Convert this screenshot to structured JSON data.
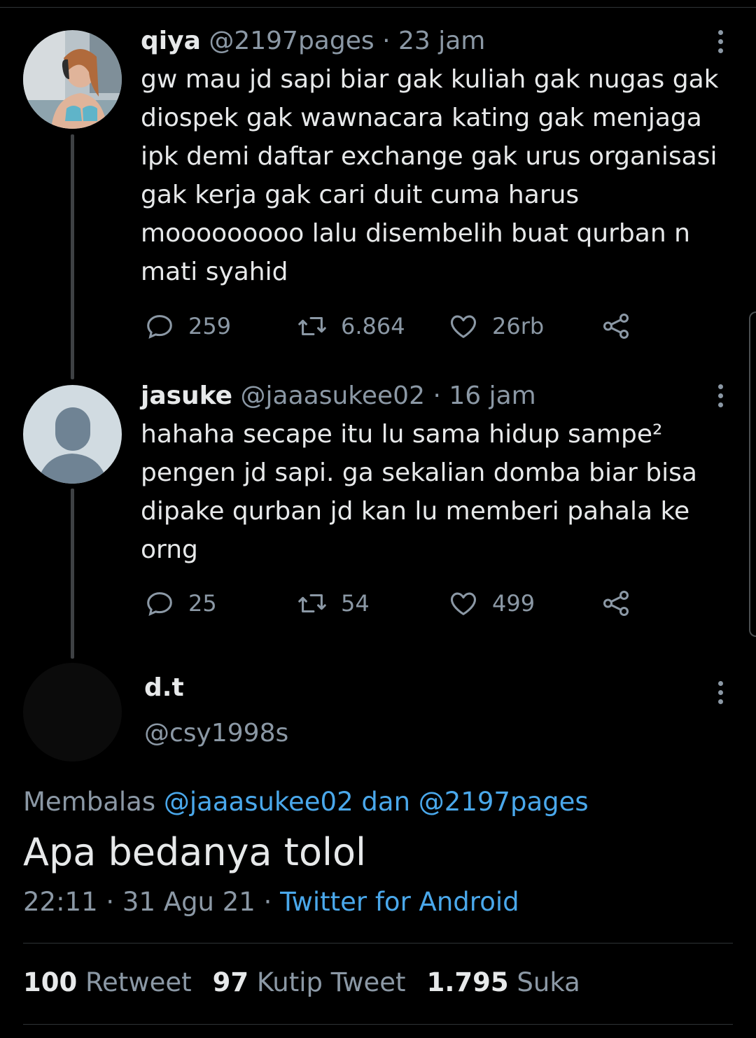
{
  "thread": [
    {
      "name": "qiya",
      "handle": "@2197pages",
      "time": "· 23 jam",
      "text": "gw mau jd sapi biar gak kuliah gak nugas gak diospek gak wawnacara kating gak menjaga ipk demi daftar exchange gak urus organisasi gak kerja gak cari duit cuma harus mooooooooo lalu disembelih buat qurban n mati syahid",
      "replies": "259",
      "retweets": "6.864",
      "likes": "26rb"
    },
    {
      "name": "jasuke",
      "handle": "@jaaasukee02",
      "time": "· 16 jam",
      "text": "hahaha secape itu lu sama hidup sampe² pengen jd sapi. ga sekalian domba biar bisa dipake qurban jd kan lu memberi pahala ke orng",
      "replies": "25",
      "retweets": "54",
      "likes": "499"
    }
  ],
  "focus": {
    "name": "d.t",
    "handle": "@csy1998s",
    "reply_prefix": "Membalas",
    "reply_user1": "@jaaasukee02",
    "reply_and": "dan",
    "reply_user2": "@2197pages",
    "text": "Apa bedanya tolol",
    "time": "22:11 · 31 Agu 21 ·",
    "source": "Twitter for Android",
    "retweet_count": "100",
    "retweet_label": "Retweet",
    "quote_count": "97",
    "quote_label": "Kutip Tweet",
    "like_count": "1.795",
    "like_label": "Suka"
  },
  "colors": {
    "background": "#000000",
    "link": "#4aa8eb",
    "secondary_text": "#8b98a5",
    "primary_text": "#e7e9ea"
  },
  "icons": [
    "reply-icon",
    "retweet-icon",
    "like-icon",
    "share-icon",
    "more-icon"
  ]
}
